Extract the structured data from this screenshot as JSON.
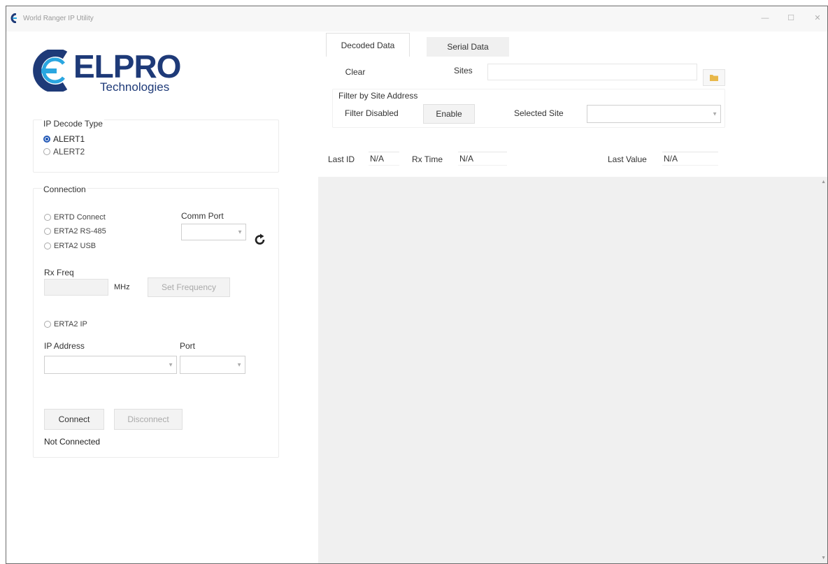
{
  "window": {
    "title": "World Ranger IP Utility",
    "controls": {
      "minimize": "—",
      "maximize": "☐",
      "close": "✕"
    }
  },
  "logo": {
    "brand": "ELPRO",
    "sub": "Technologies",
    "color": "#1e3a78",
    "accent": "#2aa6e0"
  },
  "decode_type": {
    "legend": "IP Decode Type",
    "options": [
      {
        "label": "ALERT1",
        "selected": true
      },
      {
        "label": "ALERT2",
        "selected": false
      }
    ]
  },
  "connection": {
    "legend": "Connection",
    "serial_options": [
      {
        "label": "ERTD Connect",
        "selected": false
      },
      {
        "label": "ERTA2 RS-485",
        "selected": false
      },
      {
        "label": "ERTA2 USB",
        "selected": false
      }
    ],
    "comm_port_label": "Comm Port",
    "rx_freq_label": "Rx Freq",
    "mhz_label": "MHz",
    "set_frequency_label": "Set Frequency",
    "ip_option": {
      "label": "ERTA2 IP",
      "selected": false
    },
    "ip_address_label": "IP Address",
    "port_label": "Port",
    "connect_label": "Connect",
    "disconnect_label": "Disconnect",
    "status": "Not Connected"
  },
  "tabs": [
    {
      "label": "Decoded Data",
      "active": true
    },
    {
      "label": "Serial Data",
      "active": false
    }
  ],
  "decoded": {
    "clear_label": "Clear",
    "sites_label": "Sites",
    "filter_legend": "Filter by Site Address",
    "filter_status": "Filter Disabled",
    "enable_label": "Enable",
    "selected_site_label": "Selected Site",
    "last_id_label": "Last ID",
    "last_id_value": "N/A",
    "rx_time_label": "Rx Time",
    "rx_time_value": "N/A",
    "last_value_label": "Last Value",
    "last_value_value": "N/A"
  },
  "colors": {
    "radio_selected": "#1f56b5",
    "folder_icon": "#e8b84a",
    "data_bg": "#f0f0f0"
  }
}
